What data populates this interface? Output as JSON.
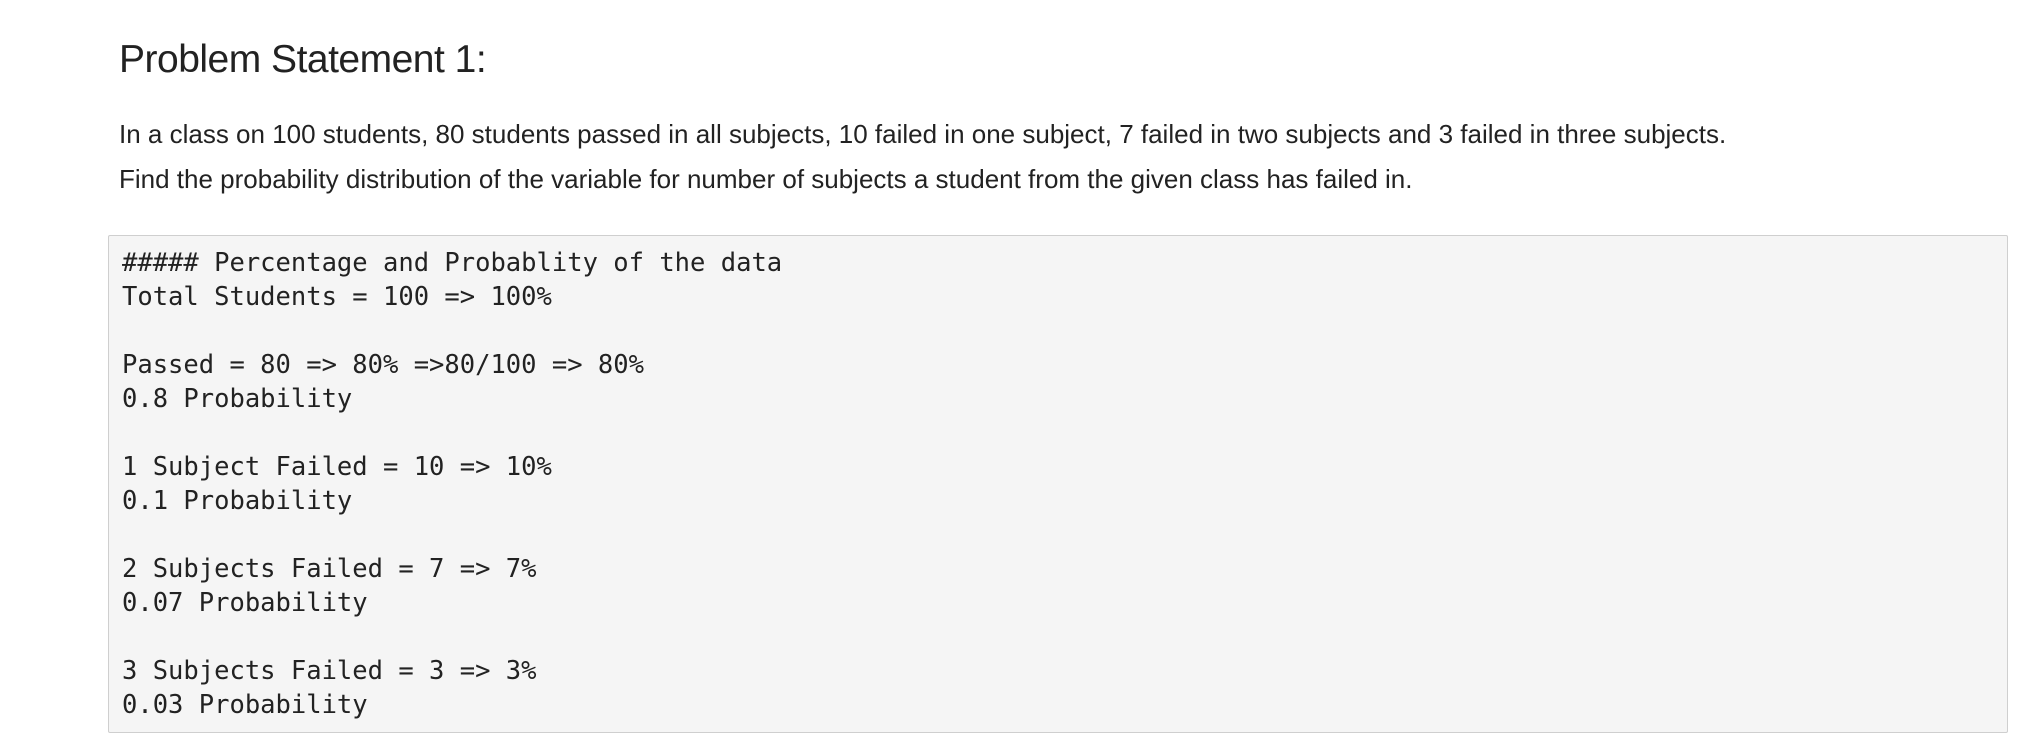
{
  "markdown_cell": {
    "heading": "Problem Statement 1:",
    "paragraph_lines": [
      "In a class on 100 students, 80 students passed in all subjects, 10 failed in one subject, 7 failed in two subjects and 3 failed in three subjects.",
      "Find the probability distribution of the variable for number of subjects a student from the given class has failed in."
    ]
  },
  "code_block": {
    "lines": [
      "##### Percentage and Probablity of the data",
      "Total Students = 100 => 100%",
      "",
      "Passed = 80 => 80% =>80/100 => 80%",
      "0.8 Probability",
      "",
      "1 Subject Failed = 10 => 10%",
      "0.1 Probability",
      "",
      "2 Subjects Failed = 7 => 7%",
      "0.07 Probability",
      "",
      "3 Subjects Failed = 3 => 3%",
      "0.03 Probability"
    ]
  }
}
